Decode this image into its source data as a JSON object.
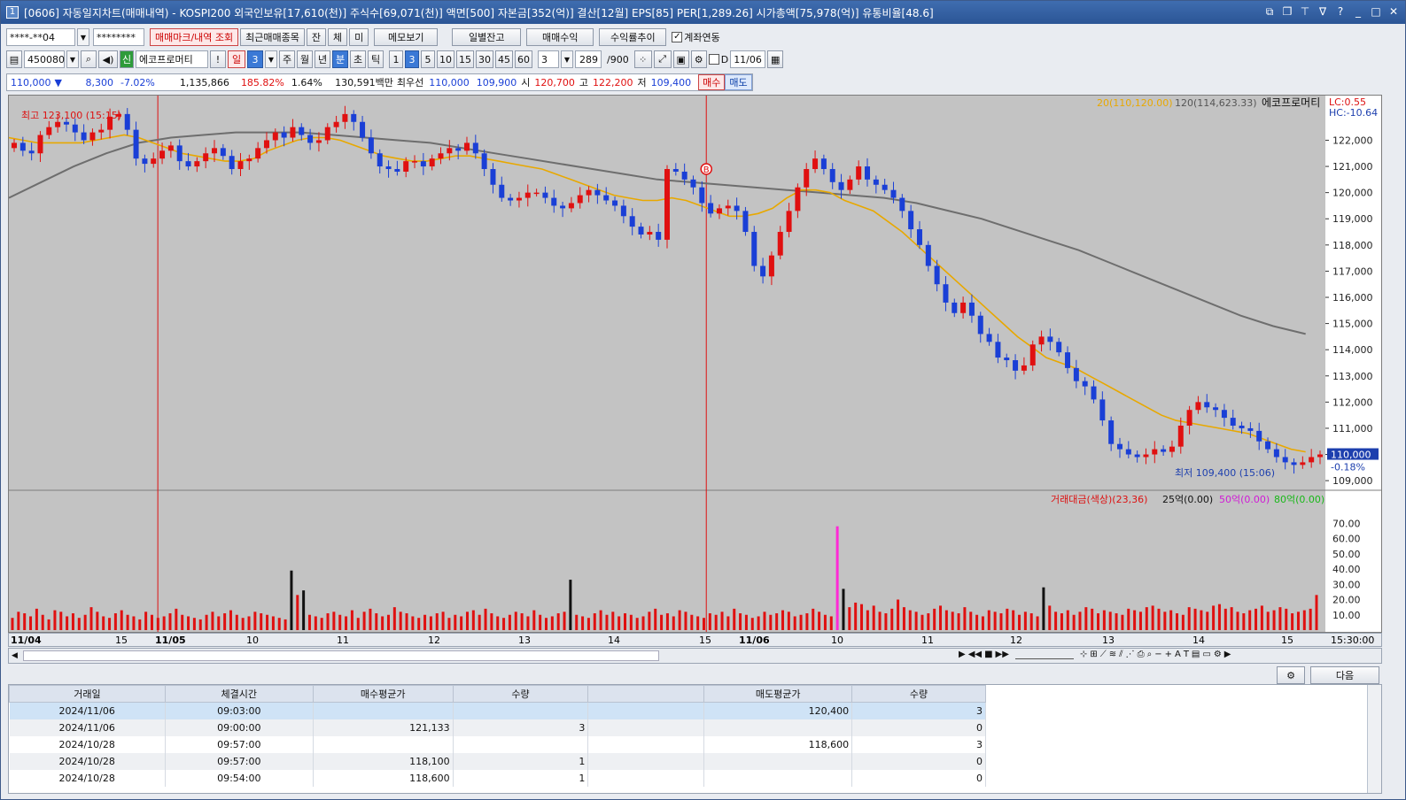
{
  "window": {
    "title": "[0606] 자동일지차트(매매내역) - KOSPI200 외국인보유[17,610(천)] 주식수[69,071(천)] 액면[500] 자본금[352(억)] 결산[12월] EPS[85] PER[1,289.26] 시가총액[75,978(억)] 유통비율[48.6]",
    "icon": "1"
  },
  "toolbar1": {
    "account": "****-**04",
    "password": "********",
    "btn_mark": "매매마크/내역 조회",
    "btn_recent": "최근매매종목",
    "btn_jan": "잔",
    "btn_che": "체",
    "btn_mi": "미",
    "btn_memo": "메모보기",
    "btn_daily": "일별잔고",
    "btn_profit": "매매수익",
    "btn_rate": "수익률추이",
    "chk_link": "계좌연동"
  },
  "toolbar2": {
    "code": "450080",
    "name": "에코프로머티",
    "badge": "신",
    "excl": "!",
    "period_day": "일",
    "period_num": "3",
    "btn_week": "주",
    "btn_month": "월",
    "btn_year": "년",
    "btn_min": "분",
    "btn_sec": "초",
    "btn_tick": "틱",
    "mins": [
      "1",
      "3",
      "5",
      "10",
      "15",
      "30",
      "45",
      "60"
    ],
    "count": "3",
    "range": "289",
    "total": "/900",
    "d_label": "D",
    "date": "11/06"
  },
  "quote": {
    "price": "110,000",
    "change": "8,300",
    "rate": "-7.02%",
    "volume": "1,135,866",
    "vol_rate": "185.82%",
    "turnover": "1.64%",
    "amount": "130,591백만",
    "best_label": "최우선",
    "ask": "110,000",
    "bid": "109,900",
    "open_label": "시",
    "open": "120,700",
    "high_label": "고",
    "high": "122,200",
    "low_label": "저",
    "low": "109,400",
    "buy": "매수",
    "sell": "매도"
  },
  "chart_data": {
    "type": "candlestick",
    "title": "에코프로머티",
    "ma_labels": [
      "20(110,120.00)",
      "120(114,623.33)"
    ],
    "lc": "LC:0.55",
    "hc": "HC:-10.64",
    "y_ticks": [
      "122,000",
      "121,000",
      "120,000",
      "119,000",
      "118,000",
      "117,000",
      "116,000",
      "115,000",
      "114,000",
      "113,000",
      "112,000",
      "111,000",
      "110,000",
      "109,000"
    ],
    "ylim": [
      108700,
      123300
    ],
    "current": "110,000",
    "current_rate": "-0.18%",
    "high_note": "최고 123,100 (15:15)",
    "low_note": "최저 109,400 (15:06)",
    "buy_marker": "B",
    "close_path": [
      121900,
      121600,
      121500,
      122200,
      122500,
      122700,
      122600,
      122300,
      122000,
      122300,
      122400,
      122900,
      123000,
      122400,
      121300,
      121100,
      121300,
      121600,
      121800,
      121200,
      121000,
      121200,
      121500,
      121700,
      121400,
      120900,
      121200,
      121300,
      121700,
      122000,
      122300,
      122100,
      122500,
      122200,
      121900,
      122000,
      122500,
      122700,
      123000,
      122700,
      122100,
      121500,
      121000,
      120900,
      120800,
      121200,
      121200,
      121000,
      121300,
      121500,
      121700,
      121600,
      121900,
      121500,
      120900,
      120300,
      119800,
      119700,
      119800,
      120000,
      120000,
      119800,
      119500,
      119400,
      119600,
      119900,
      120100,
      119900,
      119700,
      119500,
      119100,
      118700,
      118400,
      118500,
      118200,
      120900,
      120800,
      120500,
      120200,
      119600,
      119200,
      119400,
      119500,
      119300,
      118500,
      117200,
      116800,
      117600,
      118500,
      119300,
      120200,
      120900,
      121300,
      120900,
      120400,
      120100,
      120500,
      121000,
      120500,
      120300,
      120100,
      119800,
      119300,
      118600,
      118000,
      117200,
      116500,
      115800,
      115400,
      115800,
      115300,
      114600,
      114300,
      113700,
      113600,
      113200,
      113400,
      114200,
      114500,
      114300,
      113900,
      113300,
      112800,
      112600,
      112100,
      111300,
      110400,
      110200,
      110000,
      109900,
      110000,
      110200,
      110100,
      110300,
      111100,
      111700,
      112000,
      111800,
      111700,
      111400,
      111100,
      111000,
      110900,
      110500,
      110200,
      109900,
      109700,
      109600,
      109700,
      109900,
      110000
    ],
    "ma20_path": [
      122100,
      122000,
      121900,
      121900,
      121900,
      121900,
      122000,
      122100,
      122200,
      122100,
      121900,
      121700,
      121500,
      121400,
      121300,
      121200,
      121200,
      121300,
      121600,
      121800,
      122000,
      122100,
      122100,
      122000,
      121800,
      121600,
      121400,
      121300,
      121200,
      121200,
      121300,
      121400,
      121400,
      121300,
      121200,
      121100,
      121000,
      120900,
      120700,
      120500,
      120300,
      120100,
      119900,
      119800,
      119700,
      119700,
      119800,
      119700,
      119500,
      119300,
      119100,
      119100,
      119200,
      119400,
      119800,
      120100,
      120100,
      120000,
      119700,
      119500,
      119300,
      118900,
      118500,
      118000,
      117500,
      117000,
      116500,
      116000,
      115500,
      115000,
      114500,
      114100,
      113700,
      113500,
      113300,
      113000,
      112700,
      112400,
      112100,
      111800,
      111500,
      111300,
      111200,
      111100,
      111000,
      110900,
      110800,
      110600,
      110400,
      110200,
      110100
    ],
    "ma120_path": [
      119800,
      120400,
      121000,
      121500,
      121900,
      122100,
      122200,
      122300,
      122300,
      122300,
      122200,
      122100,
      122000,
      121900,
      121700,
      121500,
      121300,
      121100,
      120900,
      120700,
      120500,
      120400,
      120300,
      120200,
      120100,
      120000,
      119900,
      119800,
      119600,
      119300,
      119000,
      118600,
      118200,
      117800,
      117300,
      116800,
      116300,
      115800,
      115300,
      114900,
      114600
    ],
    "volume_title": "거래대금(색상)(23,36)",
    "volume_legend": [
      "25억(0.00)",
      "50억(0.00)",
      "80억(0.00)"
    ],
    "volume_ticks": [
      "70.00",
      "60.00",
      "50.00",
      "40.00",
      "30.00",
      "20.00",
      "10.00"
    ],
    "volume_max": 80,
    "volume_values": [
      8,
      12,
      11,
      9,
      14,
      10,
      7,
      13,
      12,
      9,
      11,
      8,
      10,
      15,
      12,
      9,
      8,
      11,
      13,
      10,
      9,
      7,
      12,
      10,
      8,
      9,
      11,
      14,
      10,
      9,
      8,
      7,
      10,
      12,
      9,
      11,
      13,
      10,
      8,
      9,
      12,
      11,
      10,
      9,
      8,
      7,
      39,
      23,
      26,
      10,
      9,
      8,
      11,
      12,
      10,
      9,
      13,
      8,
      12,
      14,
      11,
      9,
      10,
      15,
      12,
      11,
      9,
      8,
      10,
      9,
      11,
      12,
      8,
      10,
      9,
      12,
      13,
      10,
      14,
      11,
      9,
      8,
      10,
      12,
      11,
      9,
      13,
      10,
      8,
      9,
      11,
      12,
      33,
      10,
      9,
      8,
      11,
      13,
      10,
      12,
      9,
      11,
      10,
      8,
      9,
      12,
      14,
      10,
      11,
      9,
      13,
      12,
      10,
      9,
      8,
      11,
      10,
      12,
      9,
      14,
      11,
      10,
      8,
      9,
      12,
      10,
      11,
      13,
      12,
      9,
      10,
      11,
      14,
      12,
      10,
      9,
      68,
      27,
      15,
      18,
      17,
      13,
      16,
      12,
      11,
      14,
      20,
      15,
      13,
      12,
      10,
      11,
      14,
      16,
      13,
      12,
      11,
      15,
      12,
      10,
      9,
      13,
      12,
      11,
      14,
      13,
      10,
      12,
      11,
      9,
      28,
      16,
      12,
      11,
      13,
      10,
      12,
      15,
      14,
      11,
      13,
      12,
      11,
      10,
      14,
      13,
      12,
      15,
      16,
      14,
      12,
      13,
      11,
      10,
      15,
      14,
      13,
      12,
      16,
      17,
      14,
      15,
      12,
      11,
      13,
      14,
      16,
      12,
      13,
      15,
      14,
      11,
      12,
      13,
      14,
      23
    ],
    "x_ticks": [
      {
        "t": "11/04",
        "b": true
      },
      {
        "t": "15",
        "b": false
      },
      {
        "t": "11/05",
        "b": true
      },
      {
        "t": "10",
        "b": false
      },
      {
        "t": "11",
        "b": false
      },
      {
        "t": "12",
        "b": false
      },
      {
        "t": "13",
        "b": false
      },
      {
        "t": "14",
        "b": false
      },
      {
        "t": "15",
        "b": false
      },
      {
        "t": "11/06",
        "b": true
      },
      {
        "t": "10",
        "b": false
      },
      {
        "t": "11",
        "b": false
      },
      {
        "t": "12",
        "b": false
      },
      {
        "t": "13",
        "b": false
      },
      {
        "t": "14",
        "b": false
      },
      {
        "t": "15",
        "b": false
      }
    ],
    "x_end": "15:30:00"
  },
  "bottom": {
    "next": "다음"
  },
  "table": {
    "headers": [
      "거래일",
      "체결시간",
      "매수평균가",
      "수량",
      "",
      "매도평균가",
      "수량"
    ],
    "rows": [
      [
        "2024/11/06",
        "09:03:00",
        "",
        "",
        "",
        "120,400",
        "3"
      ],
      [
        "2024/11/06",
        "09:00:00",
        "121,133",
        "3",
        "",
        "",
        "0"
      ],
      [
        "2024/10/28",
        "09:57:00",
        "",
        "",
        "",
        "118,600",
        "3"
      ],
      [
        "2024/10/28",
        "09:57:00",
        "118,100",
        "1",
        "",
        "",
        "0"
      ],
      [
        "2024/10/28",
        "09:54:00",
        "118,600",
        "1",
        "",
        "",
        "0"
      ]
    ]
  },
  "colors": {
    "up": "#e01010",
    "down": "#1a3fd6",
    "ma20": "#e8a800",
    "ma120": "#6e6e6e",
    "marker": "#ff2ad6"
  }
}
